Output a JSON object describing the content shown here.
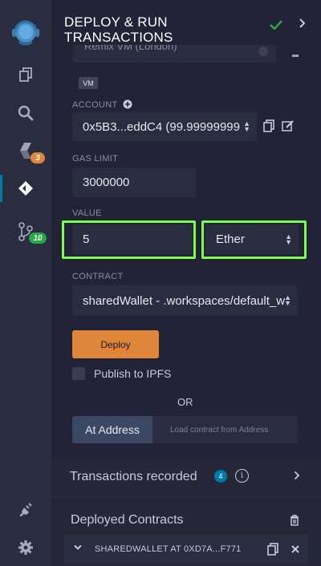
{
  "header": {
    "title_line1": "DEPLOY & RUN",
    "title_line2": "TRANSACTIONS",
    "status_icon": "check-icon",
    "collapse_icon": "chevron-right-icon"
  },
  "rail": {
    "items": [
      {
        "name": "remix-logo-icon"
      },
      {
        "name": "file-explorer-icon"
      },
      {
        "name": "search-icon"
      },
      {
        "name": "solidity-compiler-icon",
        "badge": "3"
      },
      {
        "name": "deploy-run-icon"
      },
      {
        "name": "git-icon",
        "badge": "10"
      },
      {
        "name": "plugin-manager-icon"
      },
      {
        "name": "settings-icon"
      }
    ]
  },
  "environment": {
    "value": "Remix VM (London)",
    "tag": "VM"
  },
  "account": {
    "label": "ACCOUNT",
    "value": "0x5B3...eddC4 (99.99999999"
  },
  "gas_limit": {
    "label": "GAS LIMIT",
    "value": "3000000"
  },
  "value": {
    "label": "VALUE",
    "amount": "5",
    "unit": "Ether"
  },
  "contract": {
    "label": "CONTRACT",
    "value": "sharedWallet - .workspaces/default_w"
  },
  "deploy_label": "Deploy",
  "publish_label": "Publish to IPFS",
  "or_label": "OR",
  "at_address": {
    "button_label": "At Address",
    "placeholder": "Load contract from Address"
  },
  "transactions": {
    "title": "Transactions recorded",
    "count": "4"
  },
  "deployed": {
    "title": "Deployed Contracts",
    "instances": [
      {
        "name": "SHAREDWALLET AT 0XD7A...F771"
      }
    ]
  },
  "colors": {
    "accent_blue": "#007aa6",
    "deploy_orange": "#e0863a",
    "highlight_green": "#7bff4a",
    "badge_orange": "#e0863a",
    "badge_green": "#28a745"
  }
}
